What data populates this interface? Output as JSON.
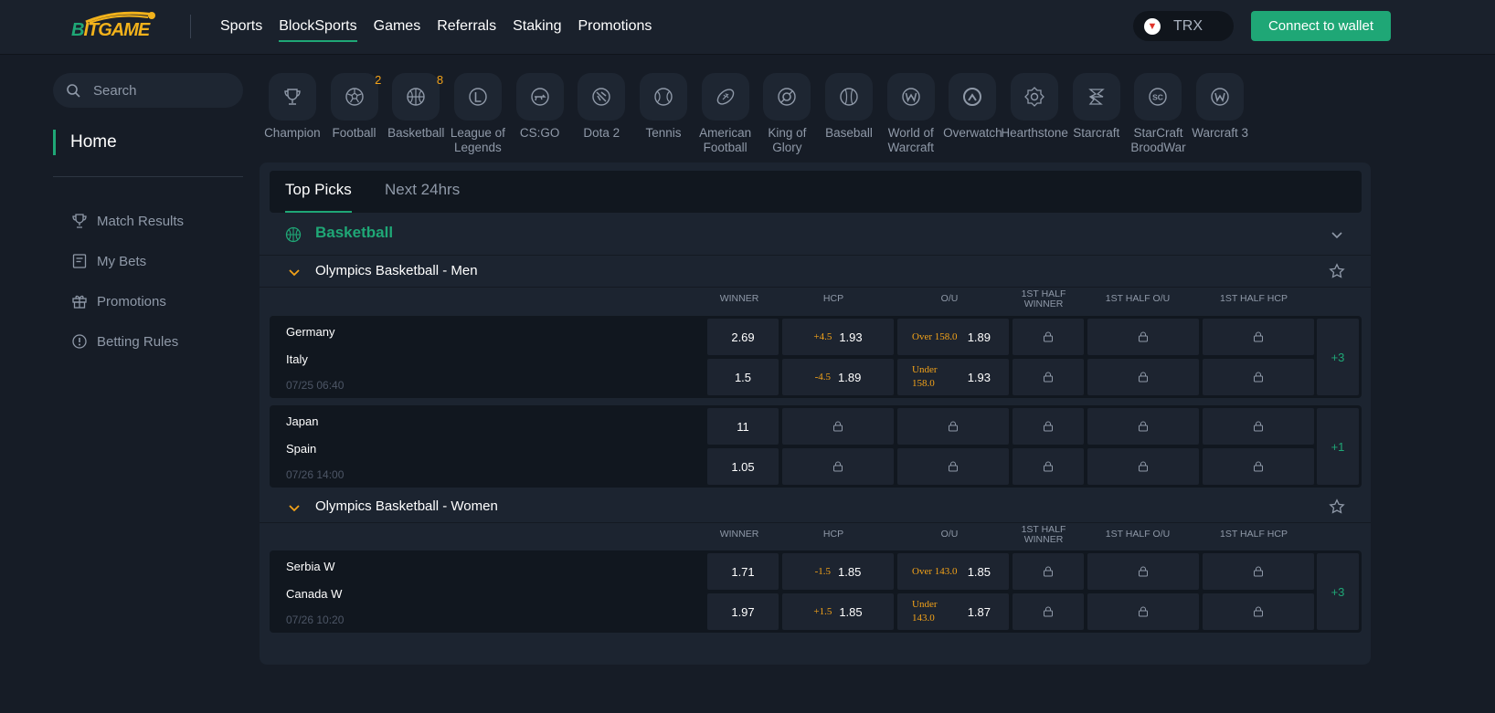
{
  "brand": {
    "logo_text_a": "B",
    "logo_text_b": "ITGAME"
  },
  "nav": {
    "links": [
      {
        "label": "Sports"
      },
      {
        "label": "BlockSports"
      },
      {
        "label": "Games"
      },
      {
        "label": "Referrals"
      },
      {
        "label": "Staking"
      },
      {
        "label": "Promotions"
      }
    ],
    "active": "BlockSports",
    "currency": "TRX",
    "connect_label": "Connect to wallet"
  },
  "sidebar": {
    "search_placeholder": "Search",
    "home_label": "Home",
    "items": [
      {
        "label": "Match Results",
        "icon": "trophy-icon"
      },
      {
        "label": "My Bets",
        "icon": "document-icon"
      },
      {
        "label": "Promotions",
        "icon": "gift-icon"
      },
      {
        "label": "Betting Rules",
        "icon": "info-icon"
      }
    ]
  },
  "categories": [
    {
      "label": "Champion",
      "count": ""
    },
    {
      "label": "Football",
      "count": "2"
    },
    {
      "label": "Basketball",
      "count": "8"
    },
    {
      "label": "League of Legends",
      "count": ""
    },
    {
      "label": "CS:GO",
      "count": ""
    },
    {
      "label": "Dota 2",
      "count": ""
    },
    {
      "label": "Tennis",
      "count": ""
    },
    {
      "label": "American Football",
      "count": ""
    },
    {
      "label": "King of Glory",
      "count": ""
    },
    {
      "label": "Baseball",
      "count": ""
    },
    {
      "label": "World of Warcraft",
      "count": ""
    },
    {
      "label": "Overwatch",
      "count": ""
    },
    {
      "label": "Hearthstone",
      "count": ""
    },
    {
      "label": "Starcraft",
      "count": ""
    },
    {
      "label": "StarCraft BroodWar",
      "count": ""
    },
    {
      "label": "Warcraft 3",
      "count": ""
    }
  ],
  "tabs": {
    "top_picks": "Top Picks",
    "next_24": "Next 24hrs"
  },
  "sport": {
    "title": "Basketball"
  },
  "columns": {
    "winner": "WINNER",
    "hcp": "HCP",
    "ou": "O/U",
    "half_winner_a": "1ST HALF",
    "half_winner_b": "WINNER",
    "half_ou": "1ST HALF O/U",
    "half_hcp": "1ST HALF HCP"
  },
  "leagues": [
    {
      "name": "Olympics Basketball - Men",
      "matches": [
        {
          "home": "Germany",
          "away": "Italy",
          "time": "07/25 06:40",
          "more": "+3",
          "winner": [
            "2.69",
            "1.5"
          ],
          "hcp": [
            {
              "line": "+4.5",
              "odd": "1.93"
            },
            {
              "line": "-4.5",
              "odd": "1.89"
            }
          ],
          "ou": [
            {
              "line": "Over 158.0",
              "odd": "1.89"
            },
            {
              "line": "Under 158.0",
              "odd": "1.93"
            }
          ]
        },
        {
          "home": "Japan",
          "away": "Spain",
          "time": "07/26 14:00",
          "more": "+1",
          "winner": [
            "11",
            "1.05"
          ]
        }
      ]
    },
    {
      "name": "Olympics Basketball - Women",
      "matches": [
        {
          "home": "Serbia W",
          "away": "Canada W",
          "time": "07/26 10:20",
          "more": "+3",
          "winner": [
            "1.71",
            "1.97"
          ],
          "hcp": [
            {
              "line": "-1.5",
              "odd": "1.85"
            },
            {
              "line": "+1.5",
              "odd": "1.85"
            }
          ],
          "ou": [
            {
              "line": "Over 143.0",
              "odd": "1.85"
            },
            {
              "line": "Under 143.0",
              "odd": "1.87"
            }
          ]
        }
      ]
    }
  ],
  "colors": {
    "accent": "#1fa776",
    "highlight": "#f2a219",
    "background": "#161c26"
  }
}
